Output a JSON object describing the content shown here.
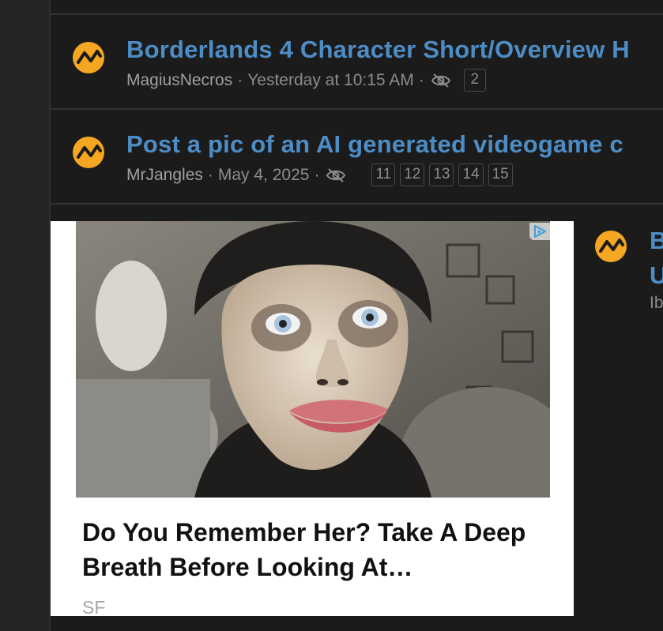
{
  "colors": {
    "link": "#4d8dc5",
    "muted": "#8c8c8c",
    "avatar_orange": "#f5a623",
    "row_bg": "#1b1b1b"
  },
  "threads": [
    {
      "title": "Borderlands 4 Character Short/Overview H",
      "author": "MagiusNecros",
      "date": "Yesterday at 10:15 AM",
      "icon": "eye-off-icon",
      "pages": [
        "2"
      ]
    },
    {
      "title": "Post a pic of an AI generated videogame c",
      "author": "MrJangles",
      "date": "May 4, 2025",
      "icon": "eye-off-icon",
      "pages": [
        "11",
        "12",
        "13",
        "14",
        "15"
      ]
    },
    {
      "title_line1": "B",
      "title_line2": "U",
      "author": "Ib"
    }
  ],
  "meta_separator": "·",
  "ad": {
    "headline": "Do You Remember Her? Take A Deep Breath Before Looking At…",
    "source": "SF",
    "choices_icon": "adchoices-icon"
  }
}
